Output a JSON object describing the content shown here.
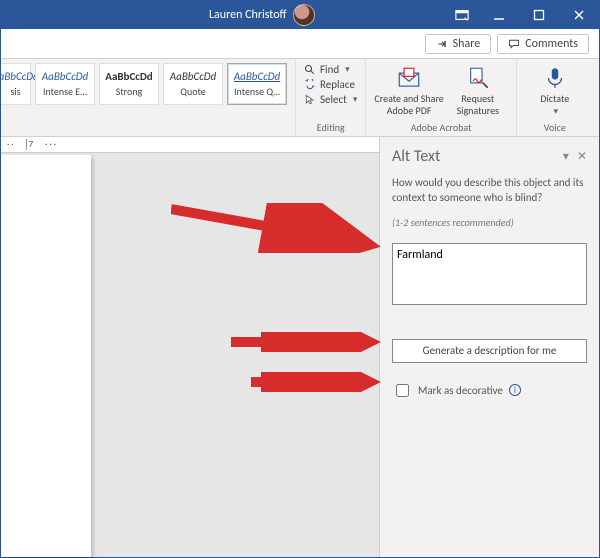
{
  "titlebar": {
    "user_name": "Lauren Christoff"
  },
  "sharebar": {
    "share_label": "Share",
    "comments_label": "Comments"
  },
  "ribbon": {
    "styles": [
      {
        "preview": "AaBbCcDd",
        "name": "sis"
      },
      {
        "preview": "AaBbCcDd",
        "name": "Intense E…"
      },
      {
        "preview": "AaBbCcDd",
        "name": "Strong"
      },
      {
        "preview": "AaBbCcDd",
        "name": "Quote"
      },
      {
        "preview": "AaBbCcDd",
        "name": "Intense Q…"
      }
    ],
    "editing": {
      "find": "Find",
      "replace": "Replace",
      "select": "Select",
      "group_label": "Editing"
    },
    "acrobat": {
      "create": "Create and Share\nAdobe PDF",
      "request": "Request\nSignatures",
      "group_label": "Adobe Acrobat"
    },
    "voice": {
      "dictate": "Dictate",
      "group_label": "Voice"
    }
  },
  "ruler": {
    "mark": "7"
  },
  "pane": {
    "title": "Alt Text",
    "desc": "How would you describe this object and its context to someone who is blind?",
    "sub": "(1-2 sentences recommended)",
    "alt_value": "Farmland",
    "generate_label": "Generate a description for me",
    "decorative_label": "Mark as decorative"
  }
}
